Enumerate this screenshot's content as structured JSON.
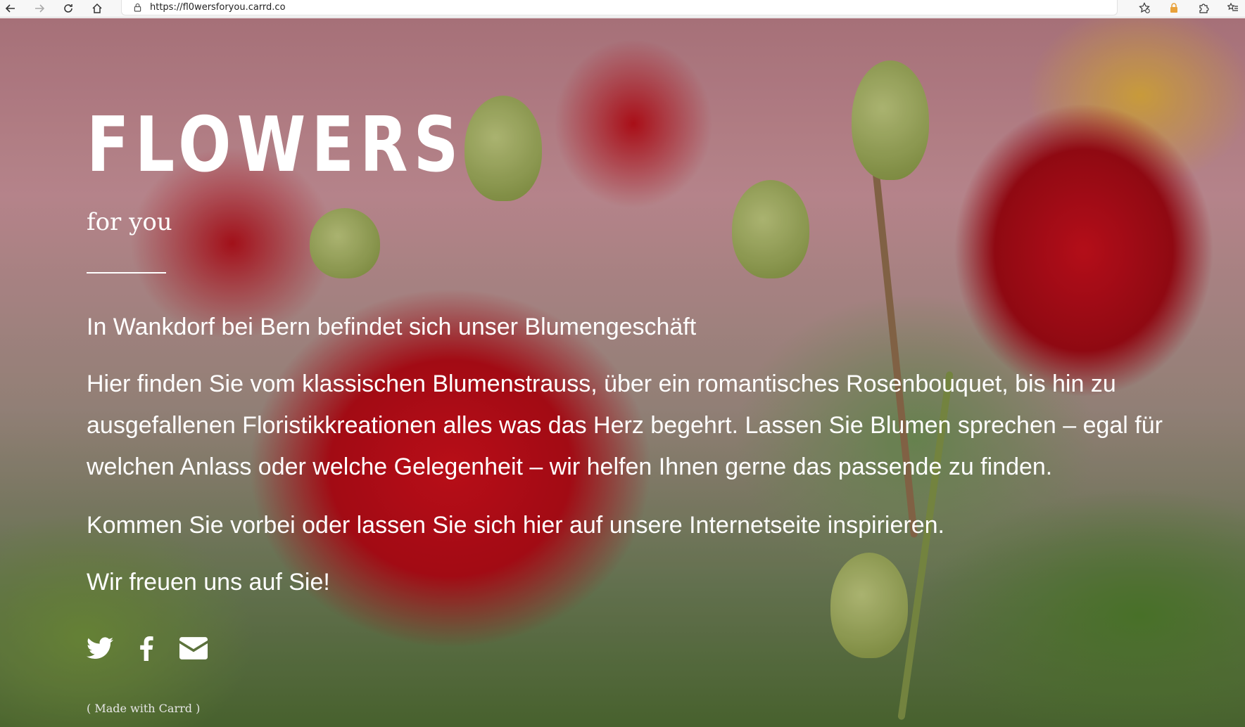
{
  "browser": {
    "url": "https://fl0wersforyou.carrd.co"
  },
  "page": {
    "title": "FLOWERS",
    "subtitle": "for you",
    "paragraphs": [
      "In Wankdorf bei Bern befindet sich unser Blumengeschäft",
      "Hier finden Sie vom klassischen Blumenstrauss, über ein romantisches Rosenbouquet, bis hin zu ausgefallenen Floristikkreationen alles was das Herz begehrt. Lassen Sie Blumen sprechen – egal für welchen Anlass oder welche Gelegenheit – wir helfen Ihnen gerne das passende zu finden.",
      "Kommen Sie vorbei oder lassen Sie sich hier auf unsere Internetseite inspirieren.",
      "Wir freuen uns auf Sie!"
    ],
    "social_icons": [
      "twitter-icon",
      "facebook-icon",
      "envelope-icon"
    ],
    "credit": "( Made with Carrd )"
  }
}
